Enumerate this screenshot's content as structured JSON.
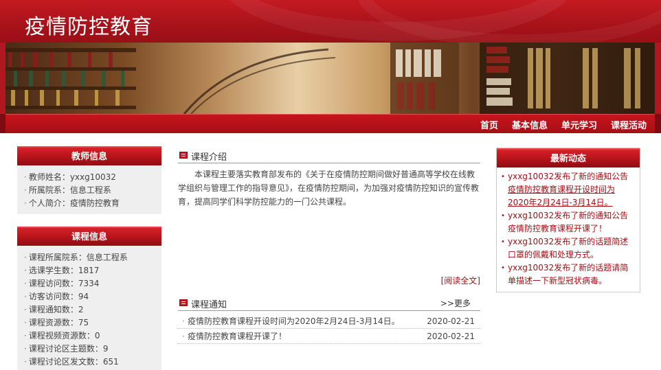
{
  "site": {
    "title": "疫情防控教育"
  },
  "nav": {
    "items": [
      "首页",
      "基本信息",
      "单元学习",
      "课程活动"
    ]
  },
  "teacher": {
    "title": "教师信息",
    "items": [
      "教师姓名：yxxg10032",
      "所属院系：信息工程系",
      "个人简介：疫情防控教育"
    ]
  },
  "course": {
    "title": "课程信息",
    "items": [
      "课程所属院系：信息工程系",
      "选课学生数：1817",
      "课程访问数：7334",
      "访客访问数：94",
      "课程通知数：2",
      "课程资源数：75",
      "课程视频资源数：0",
      "课程讨论区主题数：9",
      "课程讨论区发文数：651"
    ]
  },
  "intro": {
    "title": "课程介绍",
    "text": "本课程主要落实教育部发布的《关于在疫情防控期间做好普通高等学校在线教学组织与管理工作的指导意见》，在疫情防控期间，为加强对疫情防控知识的宣传教育，提高同学们科学防控能力的一门公共课程。",
    "read_all": "[阅读全文]"
  },
  "notices": {
    "title": "课程通知",
    "more": ">>更多",
    "items": [
      {
        "text": "疫情防控教育课程开设时间为2020年2月24日-3月14日。",
        "date": "2020-02-21"
      },
      {
        "text": "疫情防控教育课程开课了！",
        "date": "2020-02-21"
      }
    ]
  },
  "news": {
    "title": "最新动态",
    "items": [
      {
        "prefix": "yxxg10032发布了新的通知公告",
        "link": "疫情防控教育课程开设时间为2020年2月24日-3月14日。"
      },
      {
        "prefix": "yxxg10032发布了新的通知公告",
        "link": "",
        "rest": "疫情防控教育课程开课了！"
      },
      {
        "prefix": "yxxg10032发布了新的话题",
        "link": "",
        "rest": "简述口罩的佩戴和处理方式。"
      },
      {
        "prefix": "yxxg10032发布了新的话题",
        "link": "",
        "rest": "请简单描述一下新型冠状病毒。"
      }
    ]
  }
}
